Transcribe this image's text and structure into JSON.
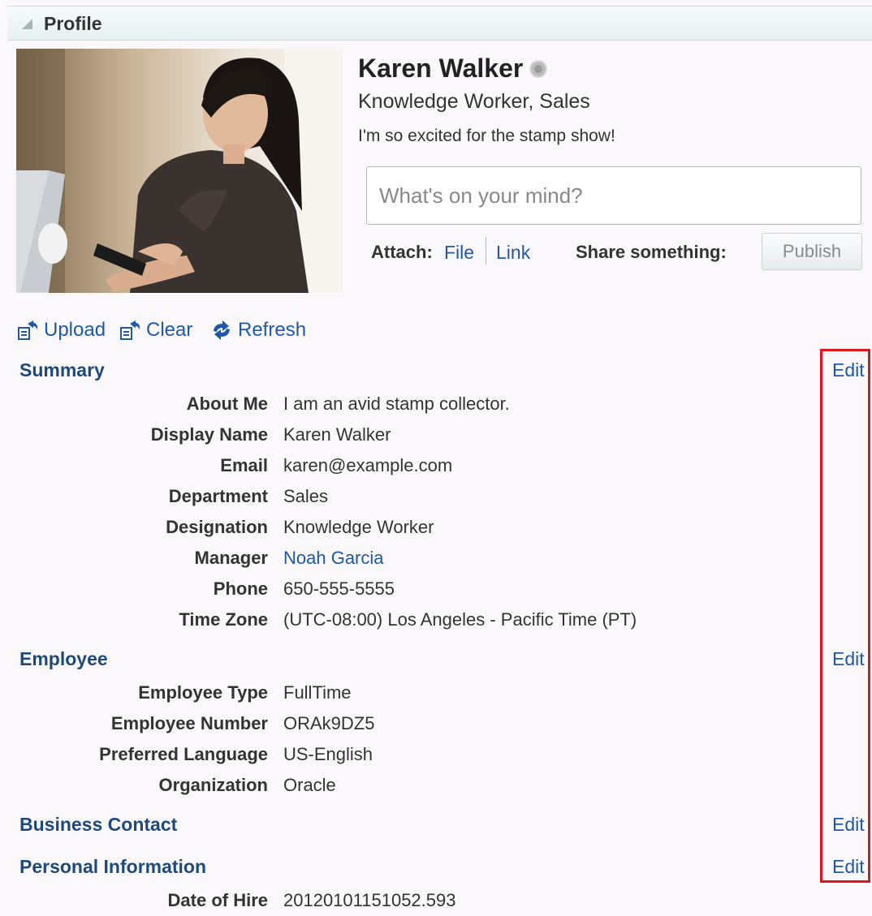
{
  "panel": {
    "title": "Profile"
  },
  "user": {
    "name": "Karen Walker",
    "title_line": "Knowledge Worker, Sales",
    "status_message": "I'm so excited for the stamp show!"
  },
  "publisher": {
    "placeholder": "What's on your mind?",
    "attach_label": "Attach:",
    "file_label": "File",
    "link_label": "Link",
    "share_label": "Share something:",
    "publish_label": "Publish"
  },
  "actions": {
    "upload": "Upload",
    "clear": "Clear",
    "refresh": "Refresh"
  },
  "edit_label": "Edit",
  "sections": {
    "summary": {
      "title": "Summary",
      "rows": [
        {
          "label": "About Me",
          "value": "I am an avid stamp collector."
        },
        {
          "label": "Display Name",
          "value": "Karen Walker"
        },
        {
          "label": "Email",
          "value": "karen@example.com"
        },
        {
          "label": "Department",
          "value": "Sales"
        },
        {
          "label": "Designation",
          "value": "Knowledge Worker"
        },
        {
          "label": "Manager",
          "value": "Noah Garcia"
        },
        {
          "label": "Phone",
          "value": "650-555-5555"
        },
        {
          "label": "Time Zone",
          "value": "(UTC-08:00) Los Angeles - Pacific Time (PT)"
        }
      ]
    },
    "employee": {
      "title": "Employee",
      "rows": [
        {
          "label": "Employee Type",
          "value": "FullTime"
        },
        {
          "label": "Employee Number",
          "value": "ORAk9DZ5"
        },
        {
          "label": "Preferred Language",
          "value": "US-English"
        },
        {
          "label": "Organization",
          "value": "Oracle"
        }
      ]
    },
    "business_contact": {
      "title": "Business Contact"
    },
    "personal": {
      "title": "Personal Information",
      "rows": [
        {
          "label": "Date of Hire",
          "value": "20120101151052.593"
        }
      ]
    }
  },
  "colors": {
    "link": "#1f59a6",
    "section_heading": "#1e4a7a",
    "highlight": "#e0141c"
  }
}
